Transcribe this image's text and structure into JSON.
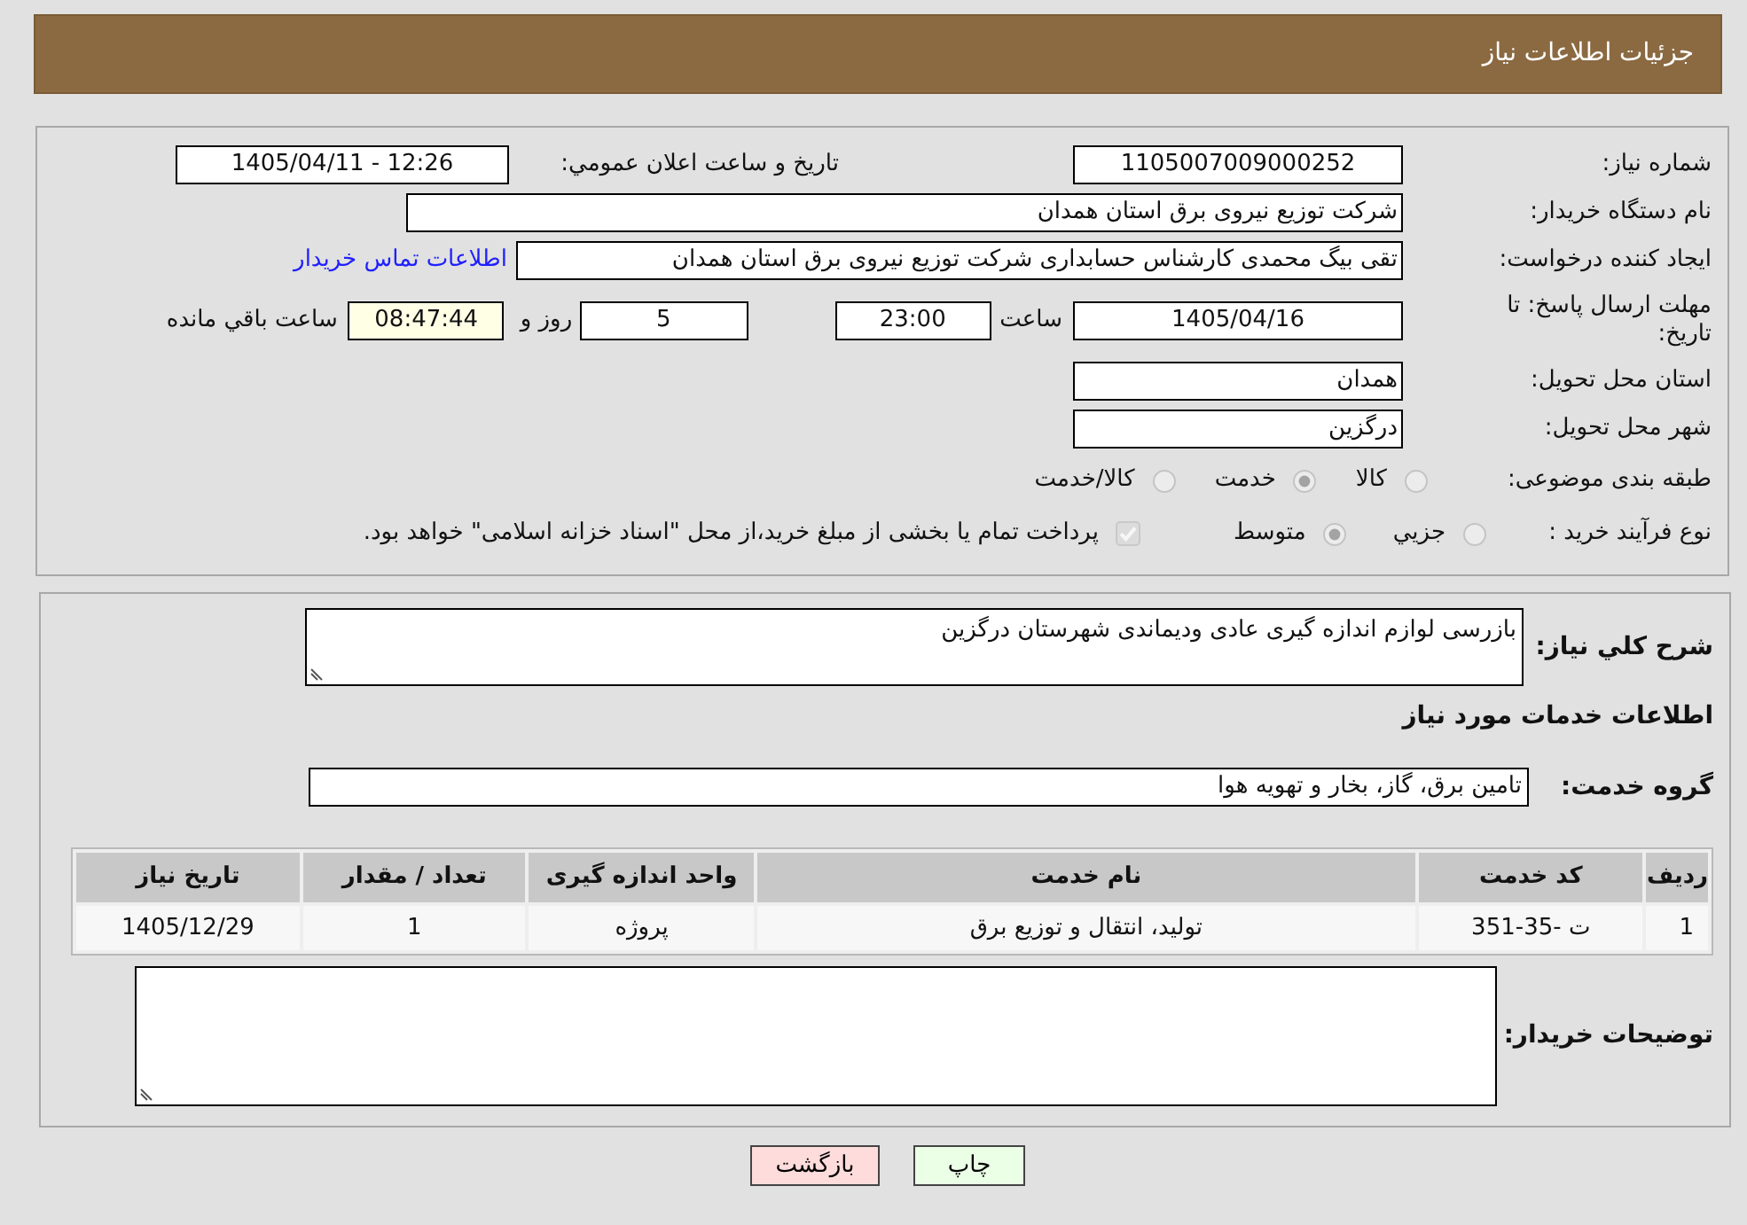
{
  "header": {
    "title": "جزئیات اطلاعات نیاز"
  },
  "details": {
    "need_number": {
      "label": "شماره نیاز:",
      "value": "1105007009000252"
    },
    "announcement": {
      "label": "تاریخ و ساعت اعلان عمومي:",
      "value": "1405/04/11 - 12:26"
    },
    "buyer_organization": {
      "label": "نام دستگاه خریدار:",
      "value": "شرکت توزیع نیروی برق استان همدان"
    },
    "requester": {
      "label": "ایجاد کننده درخواست:",
      "value": "تقی بیگ محمدی کارشناس حسابداری شرکت توزیع نیروی برق استان همدان",
      "link": "اطلاعات تماس خریدار"
    },
    "deadline": {
      "label": "مهلت ارسال پاسخ: تا تاریخ:",
      "date": "1405/04/16",
      "time_label": "ساعت",
      "time": "23:00",
      "days": "5",
      "days_label": "روز و",
      "remaining": "08:47:44",
      "remaining_label": "ساعت باقي مانده"
    },
    "province": {
      "label": "استان محل تحویل:",
      "value": "همدان"
    },
    "city": {
      "label": "شهر محل تحویل:",
      "value": "درگزین"
    },
    "category": {
      "label": "طبقه بندی موضوعی:",
      "options": [
        {
          "label": "کالا",
          "selected": false
        },
        {
          "label": "خدمت",
          "selected": true
        },
        {
          "label": "کالا/خدمت",
          "selected": false
        }
      ]
    },
    "purchase_type": {
      "label": "نوع فرآیند خرید :",
      "options": [
        {
          "label": "جزيي",
          "selected": false
        },
        {
          "label": "متوسط",
          "selected": true
        }
      ],
      "treasury": {
        "checked": true,
        "label": "پرداخت تمام یا بخشی از مبلغ خرید،از محل \"اسناد خزانه اسلامی\" خواهد بود."
      }
    }
  },
  "needs": {
    "description": {
      "label": "شرح كلي نیاز:",
      "value": "بازرسی لوازم اندازه گیری عادی ودیماندی شهرستان درگزین"
    },
    "services_title": "اطلاعات خدمات مورد نیاز",
    "service_group": {
      "label": "گروه خدمت:",
      "value": "تامین برق، گاز، بخار و تهویه هوا"
    },
    "table": {
      "columns": [
        "ردیف",
        "کد خدمت",
        "نام خدمت",
        "واحد اندازه گیری",
        "تعداد / مقدار",
        "تاریخ نیاز"
      ],
      "rows": [
        {
          "cells": [
            "1",
            "ت -35-351",
            "تولید، انتقال و توزیع برق",
            "پروژه",
            "1",
            "1405/12/29"
          ]
        }
      ]
    },
    "buyer_notes": {
      "label": "توضیحات خریدار:"
    }
  },
  "buttons": [
    {
      "kind": "print",
      "label": "چاپ"
    },
    {
      "kind": "back",
      "label": "بازگشت"
    }
  ]
}
